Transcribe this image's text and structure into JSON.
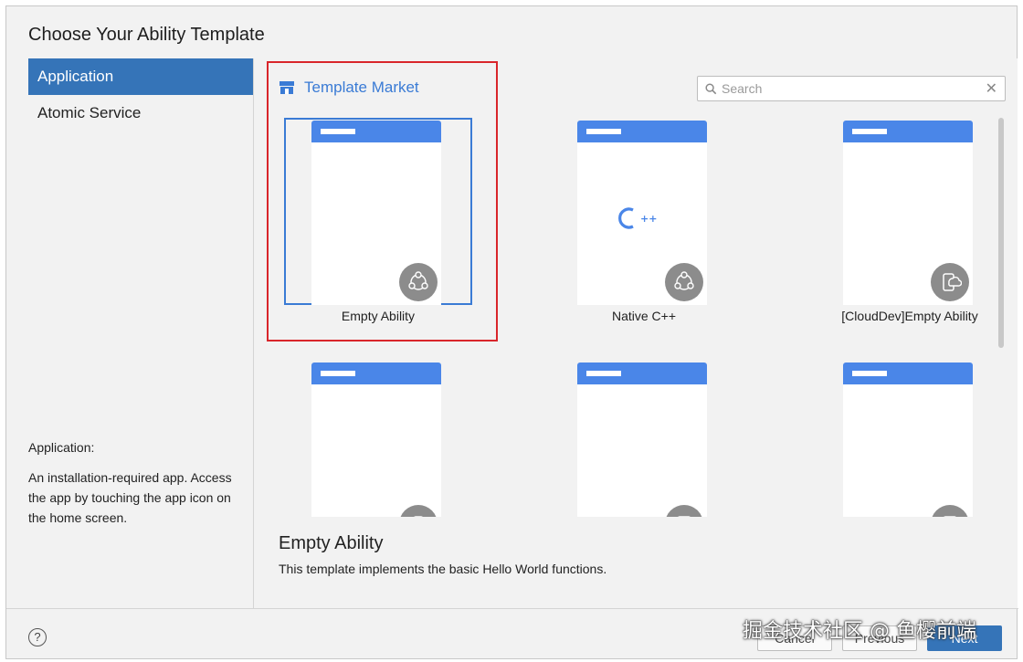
{
  "dialog": {
    "title": "Choose Your Ability Template"
  },
  "sidebar": {
    "items": [
      {
        "label": "Application",
        "active": true
      },
      {
        "label": "Atomic Service",
        "active": false
      }
    ],
    "description": {
      "heading": "Application:",
      "body": "An installation-required app. Access the app by touching the app icon on the home screen."
    }
  },
  "market": {
    "label": "Template Market",
    "icon": "store-icon"
  },
  "search": {
    "placeholder": "Search",
    "value": ""
  },
  "templates": [
    {
      "label": "Empty Ability",
      "badge_icon": "ability-circle-icon",
      "selected": true
    },
    {
      "label": "Native C++",
      "badge_icon": "ability-circle-icon",
      "center_logo": "cpp-logo",
      "selected": false
    },
    {
      "label": "[CloudDev]Empty Ability",
      "badge_icon": "cloud-device-icon",
      "selected": false
    },
    {
      "label": "",
      "badge_icon": "ability-icon"
    },
    {
      "label": "",
      "badge_icon": "device-icon"
    },
    {
      "label": "",
      "badge_icon": "device-icon"
    }
  ],
  "detail": {
    "title": "Empty Ability",
    "description": "This template implements the basic Hello World functions."
  },
  "footer": {
    "help": "?",
    "cancel": "Cancel",
    "previous": "Previous",
    "next": "Next"
  },
  "watermark": "掘金技术社区 @ 鱼樱前端",
  "colors": {
    "accent": "#3574b8",
    "highlight": "#d9262b",
    "phone_bar": "#4a86e8"
  }
}
